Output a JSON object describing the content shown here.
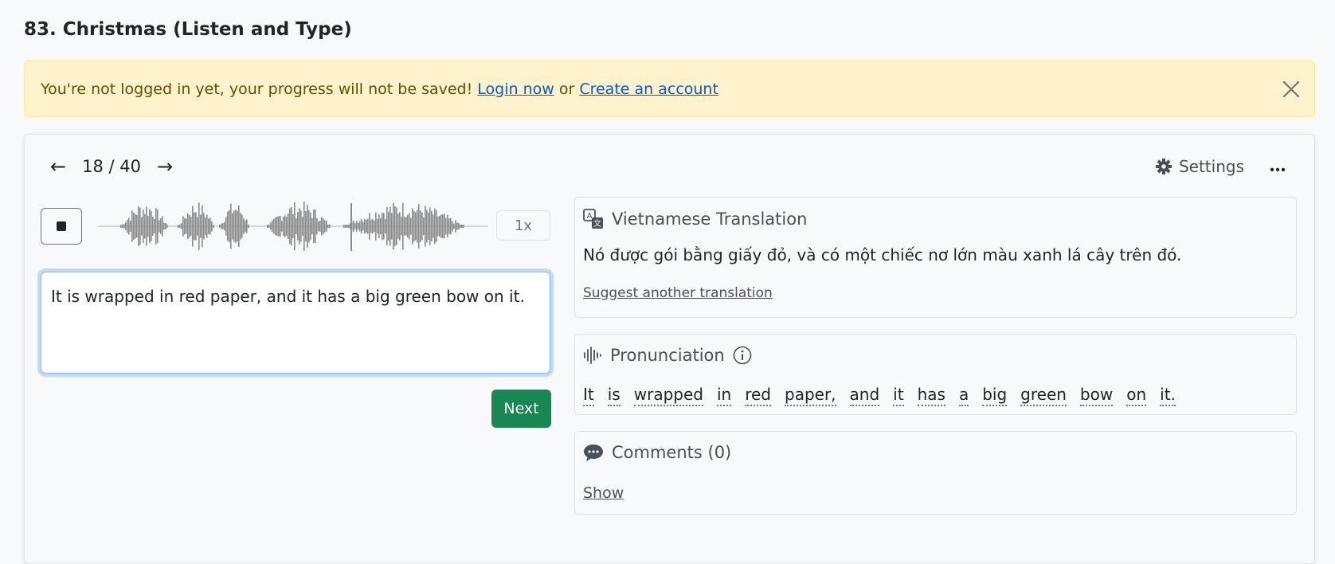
{
  "page": {
    "title": "83. Christmas (Listen and Type)"
  },
  "alert": {
    "message": "You're not logged in yet, your progress will not be saved!",
    "login_label": "Login now",
    "or_text": "or",
    "create_label": "Create an account"
  },
  "navigation": {
    "counter": "18 / 40",
    "prev_icon": "arrow-left-icon",
    "next_icon": "arrow-right-icon"
  },
  "toolbar": {
    "settings_label": "Settings",
    "more_icon": "ellipsis-icon"
  },
  "player": {
    "state": "playing",
    "speed_label": "1x"
  },
  "answer": {
    "value": "It is wrapped in red paper, and it has a big green bow on it."
  },
  "actions": {
    "next_label": "Next"
  },
  "translation": {
    "title": "Vietnamese Translation",
    "text": "Nó được gói bằng giấy đỏ, và có một chiếc nơ lớn màu xanh lá cây trên đó.",
    "suggest_label": "Suggest another translation"
  },
  "pronunciation": {
    "title": "Pronunciation",
    "words": [
      "It",
      "is",
      "wrapped",
      "in",
      "red",
      "paper,",
      "and",
      "it",
      "has",
      "a",
      "big",
      "green",
      "bow",
      "on",
      "it."
    ]
  },
  "comments": {
    "title": "Comments (0)",
    "show_label": "Show"
  },
  "colors": {
    "primary_button": "#198754",
    "alert_bg": "#fff3cd",
    "link": "#0a58ca",
    "focus_border": "#86b7fe"
  }
}
